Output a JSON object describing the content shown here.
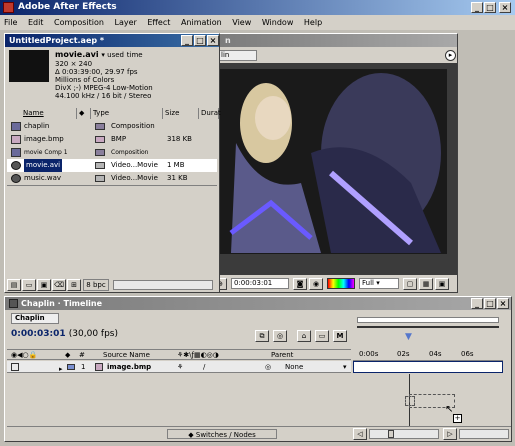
{
  "app": {
    "title": "Adobe After Effects"
  },
  "menu": [
    "File",
    "Edit",
    "Composition",
    "Layer",
    "Effect",
    "Animation",
    "View",
    "Window",
    "Help"
  ],
  "project": {
    "title": "UntitledProject.aep *",
    "preview_name": "movie.avi",
    "preview_used": "used",
    "preview_time": "time",
    "info_lines": [
      "320 × 240",
      "Δ 0:03:39:00, 29.97 fps",
      "Millions of Colors",
      "DivX ;-) MPEG-4 Low-Motion",
      "44.100 kHz / 16 bit / Stereo"
    ],
    "columns": [
      "Name",
      "Type",
      "Size",
      "Durat"
    ],
    "items": [
      {
        "name": "chaplin",
        "type": "Composition",
        "size": "",
        "color": "#8a7f9c",
        "icon": "composition-icon"
      },
      {
        "name": "image.bmp",
        "type": "BMP",
        "size": "318 KB",
        "color": "#c8a8c0",
        "icon": "image-icon"
      },
      {
        "name": "movie Comp 1",
        "type": "Composition",
        "size": "",
        "color": "#8a7f9c",
        "icon": "composition-icon"
      },
      {
        "name": "movie.avi",
        "type": "Video...Movie",
        "size": "1 MB",
        "color": "#b4b4b4",
        "icon": "movie-icon"
      },
      {
        "name": "music.wav",
        "type": "Video...Movie",
        "size": "31 KB",
        "color": "#b4b4b4",
        "icon": "audio-icon"
      }
    ],
    "bpc": "8 bpc"
  },
  "comp": {
    "tab": "lin",
    "timecode": "0:00:03:01",
    "resolution": "Full"
  },
  "timeline": {
    "title": "Chaplin · Timeline",
    "tab": "Chaplin",
    "timecode": "0:00:03:01",
    "fps": "(30,00 fps)",
    "columns": {
      "num": "#",
      "source": "Source Name",
      "parent": "Parent"
    },
    "ruler": [
      "0:00s",
      "02s",
      "04s",
      "06s"
    ],
    "layer": {
      "num": "1",
      "name": "image.bmp",
      "parent": "None"
    },
    "switches_label": "Switches / Nodes"
  }
}
